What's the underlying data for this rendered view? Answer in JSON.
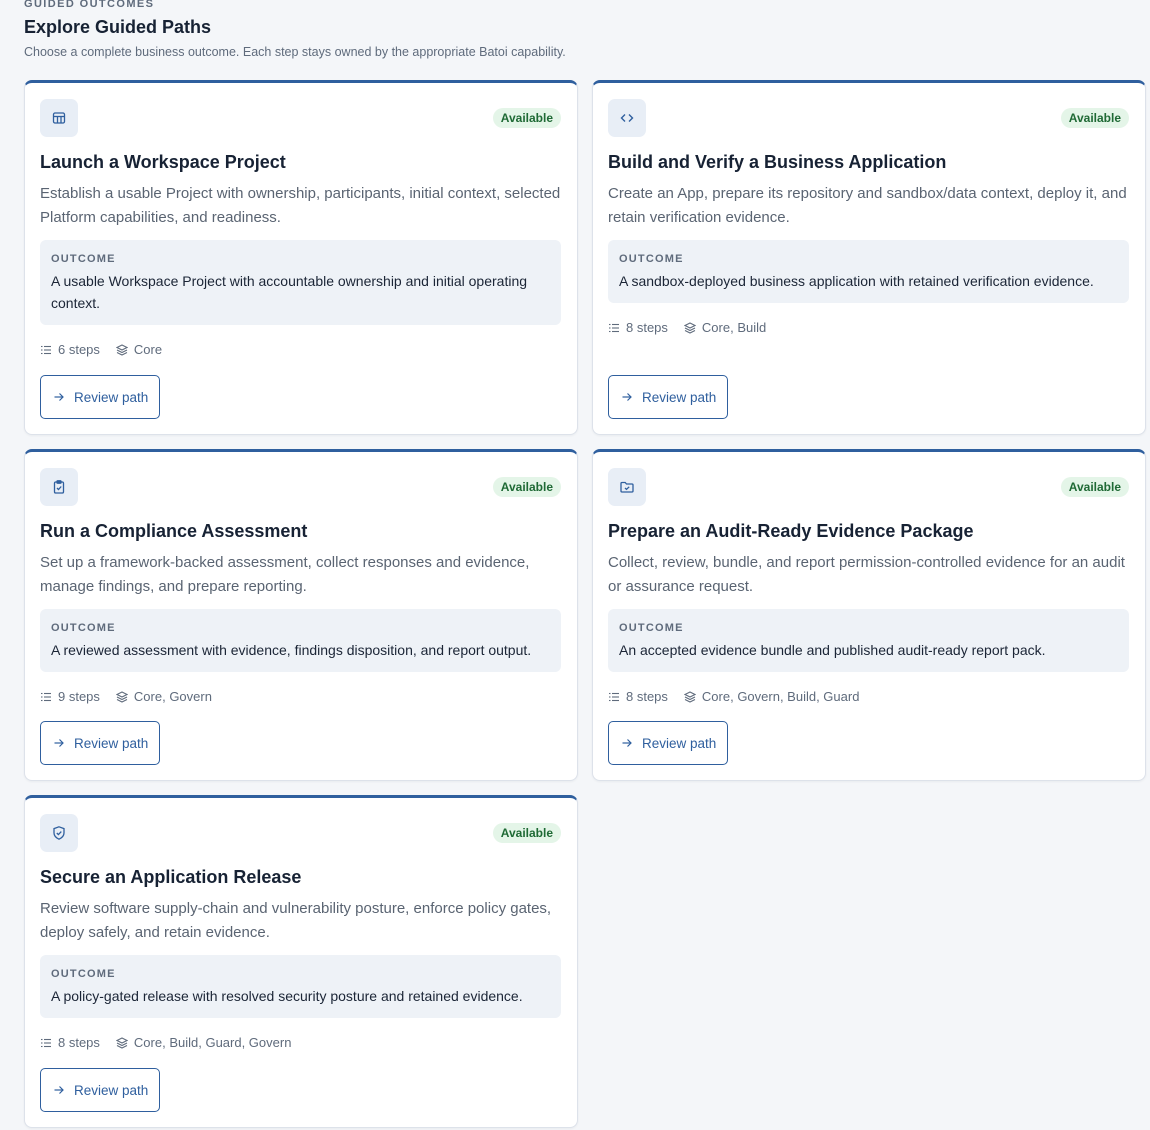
{
  "header": {
    "eyebrow": "GUIDED OUTCOMES",
    "title": "Explore Guided Paths",
    "subtitle": "Choose a complete business outcome. Each step stays owned by the appropriate Batoi capability."
  },
  "cards": [
    {
      "icon": "table-icon",
      "badge": "Available",
      "title": "Launch a Workspace Project",
      "description": "Establish a usable Project with ownership, participants, initial context, selected Platform capabilities, and readiness.",
      "outcome_label": "OUTCOME",
      "outcome": "A usable Workspace Project with accountable ownership and initial operating context.",
      "steps": "6 steps",
      "capabilities": "Core",
      "button": "Review path"
    },
    {
      "icon": "code-icon",
      "badge": "Available",
      "title": "Build and Verify a Business Application",
      "description": "Create an App, prepare its repository and sandbox/data context, deploy it, and retain verification evidence.",
      "outcome_label": "OUTCOME",
      "outcome": "A sandbox-deployed business application with retained verification evidence.",
      "steps": "8 steps",
      "capabilities": "Core, Build",
      "button": "Review path"
    },
    {
      "icon": "clipboard-check-icon",
      "badge": "Available",
      "title": "Run a Compliance Assessment",
      "description": "Set up a framework-backed assessment, collect responses and evidence, manage findings, and prepare reporting.",
      "outcome_label": "OUTCOME",
      "outcome": "A reviewed assessment with evidence, findings disposition, and report output.",
      "steps": "9 steps",
      "capabilities": "Core, Govern",
      "button": "Review path"
    },
    {
      "icon": "folder-check-icon",
      "badge": "Available",
      "title": "Prepare an Audit-Ready Evidence Package",
      "description": "Collect, review, bundle, and report permission-controlled evidence for an audit or assurance request.",
      "outcome_label": "OUTCOME",
      "outcome": "An accepted evidence bundle and published audit-ready report pack.",
      "steps": "8 steps",
      "capabilities": "Core, Govern, Build, Guard",
      "button": "Review path"
    },
    {
      "icon": "shield-check-icon",
      "badge": "Available",
      "title": "Secure an Application Release",
      "description": "Review software supply-chain and vulnerability posture, enforce policy gates, deploy safely, and retain evidence.",
      "outcome_label": "OUTCOME",
      "outcome": "A policy-gated release with resolved security posture and retained evidence.",
      "steps": "8 steps",
      "capabilities": "Core, Build, Guard, Govern",
      "button": "Review path"
    }
  ],
  "colors": {
    "accent": "#2f5f9e",
    "badge_bg": "#e4f5e8",
    "badge_text": "#1f6a35",
    "page_bg": "#f4f6f9"
  }
}
